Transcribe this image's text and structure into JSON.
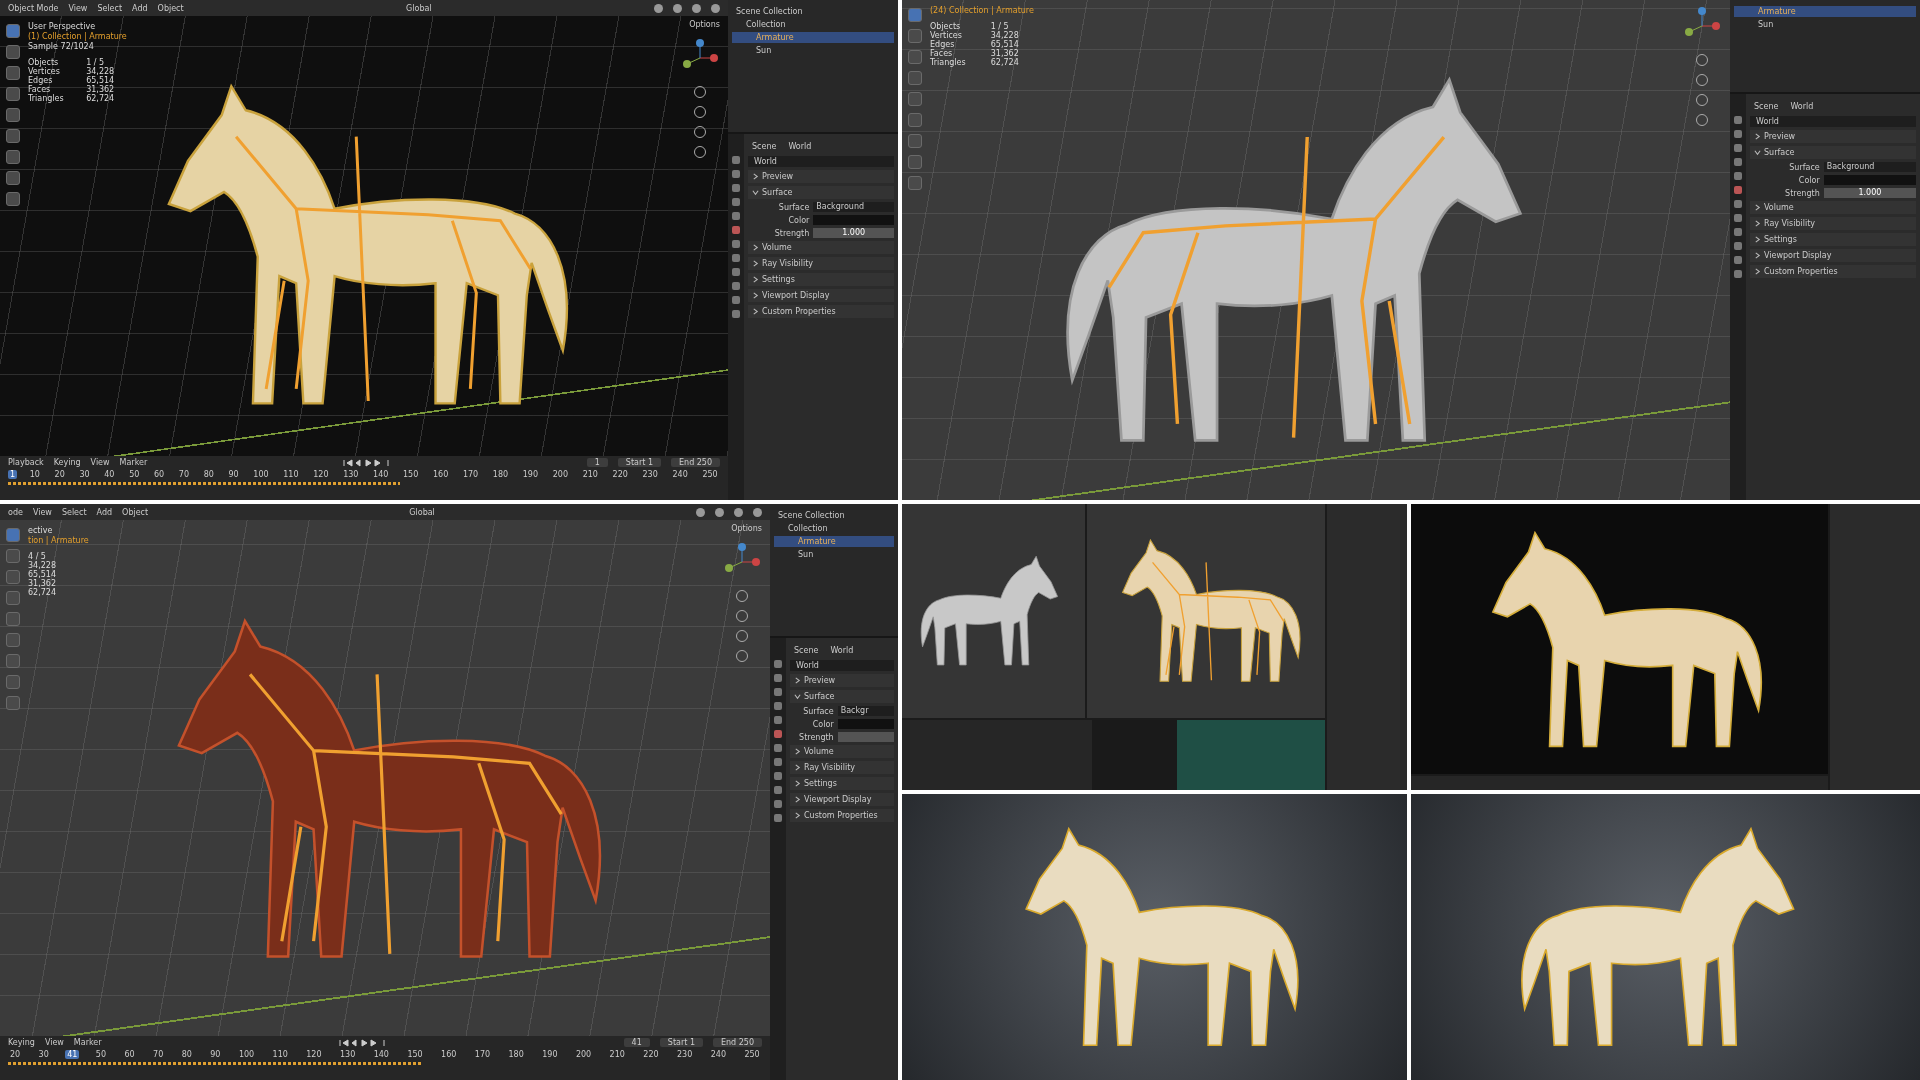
{
  "editors": [
    {
      "kind": "textured",
      "header": {
        "mode": "Object Mode",
        "menus": [
          "View",
          "Select",
          "Add",
          "Object"
        ],
        "orientation": "Global",
        "options": "Options"
      },
      "overlay": {
        "view": "User Perspective",
        "collection": "(1) Collection | Armature",
        "sample": "Sample 72/1024"
      },
      "stats": [
        {
          "label": "Objects",
          "value": "1 / 5"
        },
        {
          "label": "Vertices",
          "value": "34,228"
        },
        {
          "label": "Edges",
          "value": "65,514"
        },
        {
          "label": "Faces",
          "value": "31,362"
        },
        {
          "label": "Triangles",
          "value": "62,724"
        }
      ],
      "outliner": {
        "root": "Scene Collection",
        "collection": "Collection",
        "items": [
          {
            "label": "Armature",
            "selected": true
          },
          {
            "label": "Sun",
            "selected": false
          }
        ]
      },
      "properties": {
        "breadcrumb": [
          "Scene",
          "World"
        ],
        "world": "World",
        "sections": [
          {
            "label": "Preview",
            "expanded": false
          },
          {
            "label": "Surface",
            "expanded": true,
            "fields": [
              {
                "kind": "shader",
                "label": "Surface",
                "value": "Background"
              },
              {
                "kind": "color",
                "label": "Color"
              },
              {
                "kind": "number",
                "label": "Strength",
                "value": "1.000"
              }
            ]
          },
          {
            "label": "Volume",
            "expanded": false
          },
          {
            "label": "Ray Visibility",
            "expanded": false
          },
          {
            "label": "Settings",
            "expanded": false
          },
          {
            "label": "Viewport Display",
            "expanded": false
          },
          {
            "label": "Custom Properties",
            "expanded": false
          }
        ]
      },
      "timeline": {
        "menus": [
          "Playback",
          "Keying",
          "View",
          "Marker"
        ],
        "frame": "1",
        "start_label": "Start",
        "start": "1",
        "end_label": "End",
        "end": "250",
        "ticks": [
          {
            "label": "1",
            "selected": true
          },
          {
            "label": "10",
            "selected": false
          },
          {
            "label": "20",
            "selected": false
          },
          {
            "label": "30",
            "selected": false
          },
          {
            "label": "40",
            "selected": false
          },
          {
            "label": "50",
            "selected": false
          },
          {
            "label": "60",
            "selected": false
          },
          {
            "label": "70",
            "selected": false
          },
          {
            "label": "80",
            "selected": false
          },
          {
            "label": "90",
            "selected": false
          },
          {
            "label": "100",
            "selected": false
          },
          {
            "label": "110",
            "selected": false
          },
          {
            "label": "120",
            "selected": false
          },
          {
            "label": "130",
            "selected": false
          },
          {
            "label": "140",
            "selected": false
          },
          {
            "label": "150",
            "selected": false
          },
          {
            "label": "160",
            "selected": false
          },
          {
            "label": "170",
            "selected": false
          },
          {
            "label": "180",
            "selected": false
          },
          {
            "label": "190",
            "selected": false
          },
          {
            "label": "200",
            "selected": false
          },
          {
            "label": "210",
            "selected": false
          },
          {
            "label": "220",
            "selected": false
          },
          {
            "label": "230",
            "selected": false
          },
          {
            "label": "240",
            "selected": false
          },
          {
            "label": "250",
            "selected": false
          }
        ]
      }
    },
    {
      "kind": "clay",
      "overlay": {
        "collection": "(24) Collection | Armature"
      },
      "stats": [
        {
          "label": "Objects",
          "value": "1 / 5"
        },
        {
          "label": "Vertices",
          "value": "34,228"
        },
        {
          "label": "Edges",
          "value": "65,514"
        },
        {
          "label": "Faces",
          "value": "31,362"
        },
        {
          "label": "Triangles",
          "value": "62,724"
        }
      ],
      "outliner": {
        "items": [
          {
            "label": "Armature",
            "selected": true
          },
          {
            "label": "Sun",
            "selected": false
          }
        ]
      },
      "properties": {
        "breadcrumb": [
          "Scene",
          "World"
        ],
        "world": "World",
        "sections": [
          {
            "label": "Preview",
            "expanded": false
          },
          {
            "label": "Surface",
            "expanded": true,
            "fields": [
              {
                "kind": "shader",
                "label": "Surface",
                "value": "Background"
              },
              {
                "kind": "color",
                "label": "Color"
              },
              {
                "kind": "number",
                "label": "Strength",
                "value": "1.000"
              }
            ]
          },
          {
            "label": "Volume",
            "expanded": false
          },
          {
            "label": "Ray Visibility",
            "expanded": false
          },
          {
            "label": "Settings",
            "expanded": false
          },
          {
            "label": "Viewport Display",
            "expanded": false
          },
          {
            "label": "Custom Properties",
            "expanded": false
          }
        ]
      }
    },
    {
      "kind": "wireframe",
      "header": {
        "mode": "ode",
        "menus": [
          "View",
          "Select",
          "Add",
          "Object"
        ],
        "orientation": "Global",
        "options": "Options"
      },
      "overlay": {
        "view": "ective",
        "collection": "tion | Armature"
      },
      "stats": [
        {
          "value": "4 / 5"
        },
        {
          "value": "34,228"
        },
        {
          "value": "65,514"
        },
        {
          "value": "31,362"
        },
        {
          "value": "62,724"
        }
      ],
      "outliner": {
        "root": "Scene Collection",
        "collection": "Collection",
        "items": [
          {
            "label": "Armature",
            "selected": true
          },
          {
            "label": "Sun",
            "selected": false
          }
        ]
      },
      "properties": {
        "breadcrumb": [
          "Scene",
          "World"
        ],
        "world": "World",
        "sections": [
          {
            "label": "Preview",
            "expanded": false
          },
          {
            "label": "Surface",
            "expanded": true,
            "fields": [
              {
                "kind": "shader",
                "label": "Surface",
                "value": "Backgr"
              },
              {
                "kind": "color",
                "label": "Color"
              },
              {
                "kind": "number",
                "label": "Strength"
              }
            ]
          },
          {
            "label": "Volume",
            "expanded": false
          },
          {
            "label": "Ray Visibility",
            "expanded": false
          },
          {
            "label": "Settings",
            "expanded": false
          },
          {
            "label": "Viewport Display",
            "expanded": false
          },
          {
            "label": "Custom Properties",
            "expanded": false
          }
        ]
      },
      "timeline": {
        "menus": [
          "Keying",
          "View",
          "Marker"
        ],
        "frame": "41",
        "start_label": "Start",
        "start": "1",
        "end_label": "End",
        "end": "250",
        "ticks": [
          {
            "label": "20",
            "selected": false
          },
          {
            "label": "30",
            "selected": false
          },
          {
            "label": "41",
            "selected": true
          },
          {
            "label": "50",
            "selected": false
          },
          {
            "label": "60",
            "selected": false
          },
          {
            "label": "70",
            "selected": false
          },
          {
            "label": "80",
            "selected": false
          },
          {
            "label": "90",
            "selected": false
          },
          {
            "label": "100",
            "selected": false
          },
          {
            "label": "110",
            "selected": false
          },
          {
            "label": "120",
            "selected": false
          },
          {
            "label": "130",
            "selected": false
          },
          {
            "label": "140",
            "selected": false
          },
          {
            "label": "150",
            "selected": false
          },
          {
            "label": "160",
            "selected": false
          },
          {
            "label": "170",
            "selected": false
          },
          {
            "label": "180",
            "selected": false
          },
          {
            "label": "190",
            "selected": false
          },
          {
            "label": "200",
            "selected": false
          },
          {
            "label": "210",
            "selected": false
          },
          {
            "label": "220",
            "selected": false
          },
          {
            "label": "230",
            "selected": false
          },
          {
            "label": "240",
            "selected": false
          },
          {
            "label": "250",
            "selected": false
          }
        ]
      }
    }
  ],
  "thumbnails": [
    {
      "kind": "split"
    },
    {
      "kind": "single"
    }
  ]
}
